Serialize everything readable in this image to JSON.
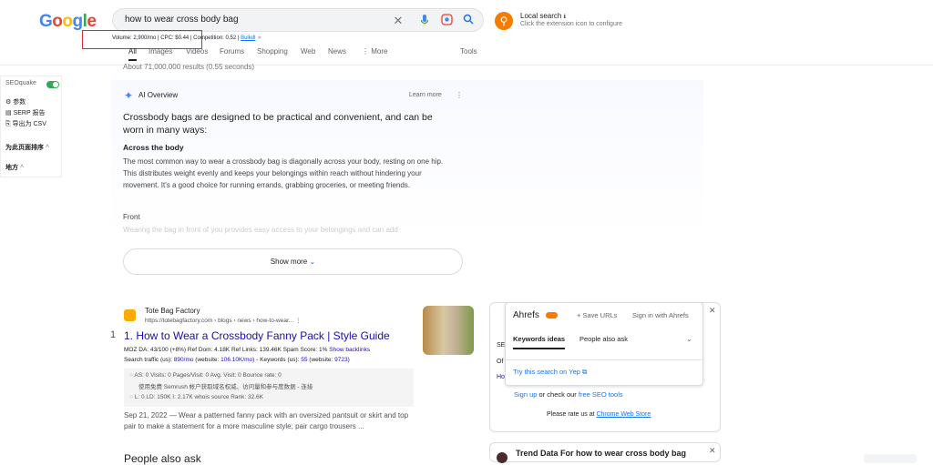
{
  "header": {
    "logo_letters": [
      {
        "ch": "G",
        "color": "#4285f4"
      },
      {
        "ch": "o",
        "color": "#ea4335"
      },
      {
        "ch": "o",
        "color": "#fbbc05"
      },
      {
        "ch": "g",
        "color": "#4285f4"
      },
      {
        "ch": "l",
        "color": "#34a853"
      },
      {
        "ch": "e",
        "color": "#ea4335"
      }
    ],
    "search_query": "how to wear cross body bag",
    "local_search_title": "Local search",
    "local_search_sub": "Click the extension icon to configure"
  },
  "seoquake_line": {
    "text": "Volume: 2,900/mo | CPC: $0.44 | Competition: 0.52 | ",
    "link": "Bulkdl"
  },
  "tabs": [
    "All",
    "Images",
    "Videos",
    "Forums",
    "Shopping",
    "Web",
    "News",
    "More",
    "Tools"
  ],
  "result_stats": "About 71,000,000 results (0.55 seconds)",
  "sidebar": {
    "brand": "SEOquake",
    "items": [
      "参数",
      "SERP 报告",
      "导出为 CSV"
    ],
    "sort_label": "为此页面排序",
    "region_label": "地方"
  },
  "ai_overview": {
    "label": "AI Overview",
    "learn_more": "Learn more",
    "heading": "Crossbody bags are designed to be practical and convenient, and can be worn in many ways:",
    "subheading": "Across the body",
    "paragraph": "The most common way to wear a crossbody bag is diagonally across your body, resting on one hip. This distributes weight evenly and keeps your belongings within reach without hindering your movement. It's a good choice for running errands, grabbing groceries, or meeting friends.",
    "next_label": "Front",
    "faded_text": "Wearing the bag in front of you provides easy access to your belongings and can add",
    "show_more": "Show more"
  },
  "result1": {
    "site_name": "Tote Bag Factory",
    "url": "https://totebagfactory.com › blogs › news › how-to-wear...",
    "rank": "1",
    "title": "1. How to Wear a Crossbody Fanny Pack | Style Guide",
    "metrics_line1": "MOZ DA: 43/100 (+8%)   Ref Dom: 4.18K   Ref Links: 139.46K   Spam Score: 1%",
    "backlinks_link": "Show backlinks",
    "metrics_line2_pre": "Search traffic (us): ",
    "traffic": "890/mo",
    "metrics_line2_mid": " (website: ",
    "traffic_site": "106.10K/mo",
    "metrics_line2_mid2": ") - Keywords (us): ",
    "keywords": "55",
    "metrics_line2_mid3": " (website: ",
    "keywords_site": "9723",
    "metrics_line2_end": ")",
    "semrush_row1": "AS: 0       Visits: 0    Pages/Visit: 0    Avg. Visit: 0    Bounce rate: 0",
    "semrush_row2": "使用免费 Semrush 帐户获取域名权威、访问量和参与度数据 - 连接",
    "semrush_row3": "L: 0    LD: 150K    I: 2.17K    whois    source    Rank: 32.6K",
    "snippet": "Sep 21, 2022 — Wear a patterned fanny pack with an oversized pantsuit or skirt and top pair to make a statement for a more masculine style; pair cargo trousers ..."
  },
  "next_heading": "People also ask",
  "ahrefs": {
    "title": "Ahrefs",
    "save_urls": "Save URLs",
    "sign_in": "Sign in with Ahrefs",
    "tab_keywords": "Keywords ideas",
    "tab_people": "People also ask",
    "yep": "Try this search on Yep",
    "signup": "Sign up",
    "signup_mid": " or check our ",
    "seo_tools": "free SEO tools",
    "rate_pre": "Please rate us at ",
    "rate_link": "Chrome Web Store"
  },
  "side_fragments": [
    "SE",
    "Of",
    "Ho"
  ],
  "trend": {
    "title": "Trend Data For how to wear cross body bag"
  }
}
